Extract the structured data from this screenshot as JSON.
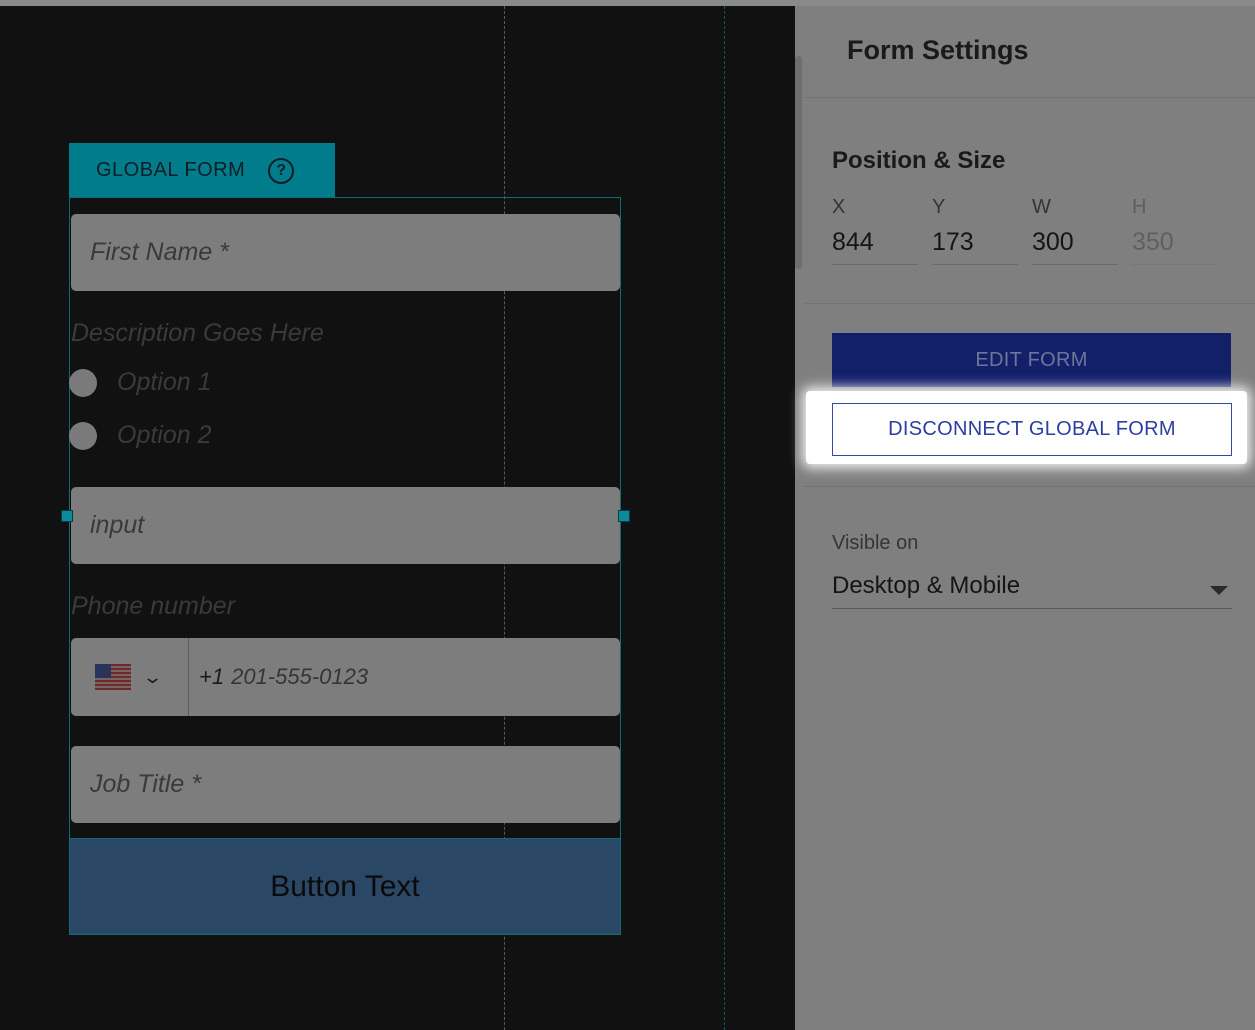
{
  "canvas": {
    "form_badge": {
      "label": "GLOBAL FORM",
      "help_icon": "question-circle-icon"
    },
    "fields": {
      "first_name": "First Name *",
      "description": "Description Goes Here",
      "options": [
        "Option 1",
        "Option 2"
      ],
      "input": "input",
      "phone_label": "Phone number",
      "phone_country": "us-flag-icon",
      "phone_prefix": "+1",
      "phone_placeholder": "201-555-0123",
      "job_title": "Job Title *"
    },
    "submit_label": "Button Text"
  },
  "sidebar": {
    "title": "Form Settings",
    "position_size": {
      "title": "Position & Size",
      "x": {
        "label": "X",
        "value": "844"
      },
      "y": {
        "label": "Y",
        "value": "173"
      },
      "w": {
        "label": "W",
        "value": "300"
      },
      "h": {
        "label": "H",
        "value": "350"
      }
    },
    "edit_form_label": "EDIT FORM",
    "disconnect_label": "DISCONNECT GLOBAL FORM",
    "visible_on": {
      "label": "Visible on",
      "value": "Desktop & Mobile"
    }
  },
  "colors": {
    "accent_teal": "#007c8c",
    "edit_button": "#12206a",
    "disconnect_text": "#2d3ea3",
    "submit_button": "#2a4866"
  }
}
